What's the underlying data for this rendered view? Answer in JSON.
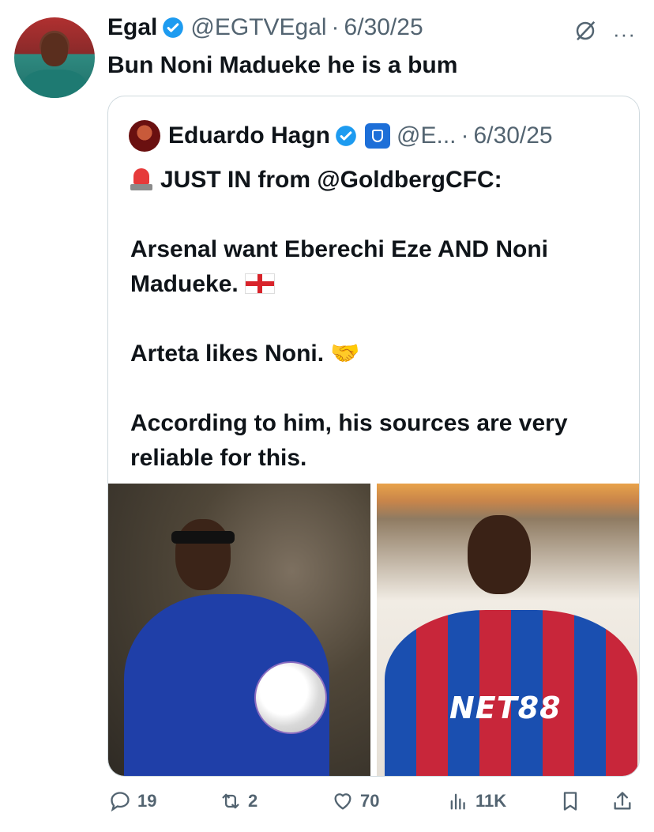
{
  "tweet": {
    "author_name": "Egal",
    "handle": "@EGTVEgal",
    "date": "6/30/25",
    "text": "Bun Noni Madueke he is a bum",
    "separator": "·"
  },
  "quoted_tweet": {
    "author_name": "Eduardo Hagn",
    "handle": "@E...",
    "date": "6/30/25",
    "line1": "JUST IN from @GoldbergCFC:",
    "line2": "Arsenal want Eberechi Eze AND Noni Madueke.",
    "line3": "Arteta likes Noni.",
    "line4": "According to him, his sources are very reliable for this.",
    "image_right_sponsor": "NET88"
  },
  "actions": {
    "replies": "19",
    "reposts": "2",
    "likes": "70",
    "views": "11K"
  },
  "colors": {
    "verified_blue": "#1d9bf0",
    "muted_text": "#536471",
    "border": "#cfd9de"
  },
  "icons": [
    "verified-icon",
    "grok-icon",
    "more-icon",
    "siren-icon",
    "england-flag-icon",
    "handshake-icon",
    "reply-icon",
    "repost-icon",
    "like-icon",
    "views-icon",
    "bookmark-icon",
    "share-icon"
  ]
}
